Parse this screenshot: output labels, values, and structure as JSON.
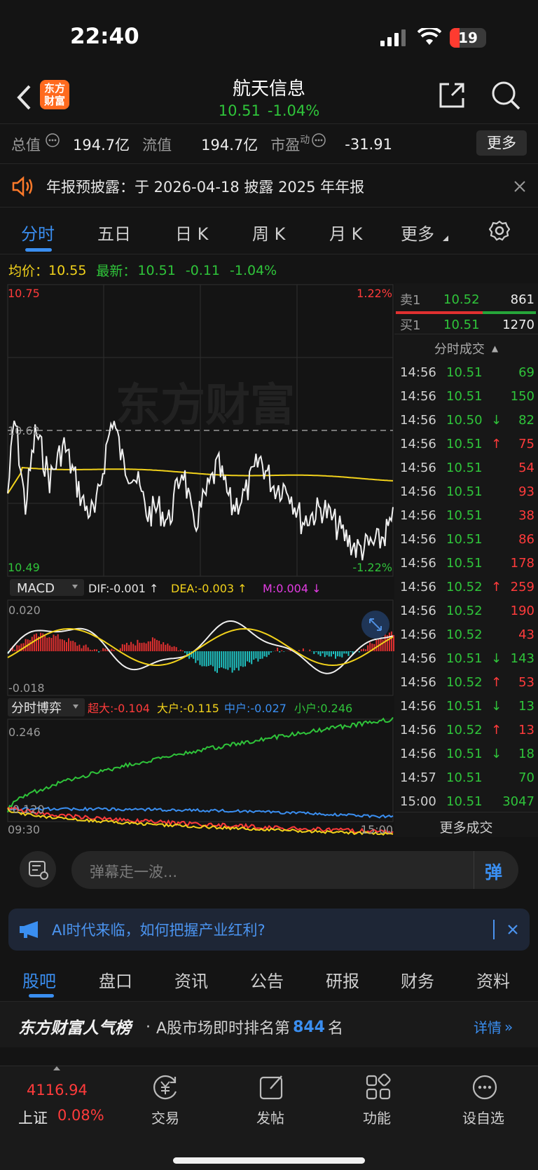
{
  "status_bar": {
    "time": "22:40",
    "battery": "19"
  },
  "nav": {
    "back_icon": "chevron-left-icon",
    "logo_text": "东方\n财富",
    "title": "航天信息",
    "price": "10.51",
    "change_pct": "-1.04%",
    "share_icon": "share-icon",
    "search_icon": "search-icon"
  },
  "stats": {
    "total_label": "总值",
    "total_value": "194.7亿",
    "float_label": "流值",
    "float_value": "194.7亿",
    "pe_label": "市盈",
    "pe_sup": "动",
    "pe_value": "-31.91",
    "more_button": "更多"
  },
  "notice": {
    "text": "年报预披露：于 2026-04-18 披露 2025 年年报",
    "close_icon": "close-icon"
  },
  "period_tabs": [
    {
      "label": "分时",
      "active": true
    },
    {
      "label": "五日"
    },
    {
      "label": "日 K"
    },
    {
      "label": "周 K"
    },
    {
      "label": "月 K"
    },
    {
      "label": "更多"
    }
  ],
  "settings_icon": "gear-icon",
  "quote_line": {
    "avg_label": "均价：",
    "avg_value": "10.55",
    "latest_label": "最新：",
    "latest_value": "10.51",
    "change": "-0.11",
    "change_pct": "-1.04%"
  },
  "price_chart": {
    "max_price": "10.75",
    "max_pct": "1.22%",
    "pre_close": "10.62",
    "min_price": "10.49",
    "min_pct": "-1.22%",
    "watermark": "东方财富"
  },
  "macd": {
    "label": "MACD",
    "dif": "DIF:-0.001 ↑",
    "dea": "DEA:-0.003 ↑",
    "m": "M:0.004 ↓",
    "max": "0.020",
    "min": "-0.018"
  },
  "game": {
    "label": "分时博弈",
    "super": "超大:-0.104",
    "large": "大户:-0.115",
    "mid": "中户:-0.027",
    "small": "小户:0.246",
    "max": "0.246",
    "min": "-0.120",
    "start_time": "09:30",
    "end_time": "15:00"
  },
  "order_book": {
    "sell": {
      "label": "卖1",
      "price": "10.52",
      "vol": "861"
    },
    "buy": {
      "label": "买1",
      "price": "10.51",
      "vol": "1270"
    },
    "trades_header": "分时成交",
    "more_trades": "更多成交"
  },
  "trades": [
    {
      "t": "14:56",
      "p": "10.51",
      "a": "",
      "v": "69",
      "pc": "g",
      "vc": "g"
    },
    {
      "t": "14:56",
      "p": "10.51",
      "a": "",
      "v": "150",
      "pc": "g",
      "vc": "g"
    },
    {
      "t": "14:56",
      "p": "10.50",
      "a": "↓",
      "v": "82",
      "pc": "g",
      "vc": "g"
    },
    {
      "t": "14:56",
      "p": "10.51",
      "a": "↑",
      "v": "75",
      "pc": "g",
      "vc": "r"
    },
    {
      "t": "14:56",
      "p": "10.51",
      "a": "",
      "v": "54",
      "pc": "g",
      "vc": "r"
    },
    {
      "t": "14:56",
      "p": "10.51",
      "a": "",
      "v": "93",
      "pc": "g",
      "vc": "r"
    },
    {
      "t": "14:56",
      "p": "10.51",
      "a": "",
      "v": "38",
      "pc": "g",
      "vc": "r"
    },
    {
      "t": "14:56",
      "p": "10.51",
      "a": "",
      "v": "86",
      "pc": "g",
      "vc": "r"
    },
    {
      "t": "14:56",
      "p": "10.51",
      "a": "",
      "v": "178",
      "pc": "g",
      "vc": "r"
    },
    {
      "t": "14:56",
      "p": "10.52",
      "a": "↑",
      "v": "259",
      "pc": "g",
      "vc": "r"
    },
    {
      "t": "14:56",
      "p": "10.52",
      "a": "",
      "v": "190",
      "pc": "g",
      "vc": "r"
    },
    {
      "t": "14:56",
      "p": "10.52",
      "a": "",
      "v": "43",
      "pc": "g",
      "vc": "r"
    },
    {
      "t": "14:56",
      "p": "10.51",
      "a": "↓",
      "v": "143",
      "pc": "g",
      "vc": "g"
    },
    {
      "t": "14:56",
      "p": "10.52",
      "a": "↑",
      "v": "53",
      "pc": "g",
      "vc": "r"
    },
    {
      "t": "14:56",
      "p": "10.51",
      "a": "↓",
      "v": "13",
      "pc": "g",
      "vc": "g"
    },
    {
      "t": "14:56",
      "p": "10.52",
      "a": "↑",
      "v": "13",
      "pc": "g",
      "vc": "r"
    },
    {
      "t": "14:56",
      "p": "10.51",
      "a": "↓",
      "v": "18",
      "pc": "g",
      "vc": "g"
    },
    {
      "t": "14:57",
      "p": "10.51",
      "a": "",
      "v": "70",
      "pc": "g",
      "vc": "g"
    },
    {
      "t": "15:00",
      "p": "10.51",
      "a": "",
      "v": "3047",
      "pc": "g",
      "vc": "g"
    }
  ],
  "barrage": {
    "placeholder": "弹幕走一波...",
    "button": "弹"
  },
  "ai_banner": {
    "text": "AI时代来临，如何把握产业红利?"
  },
  "bottom_tabs": [
    "股吧",
    "盘口",
    "资讯",
    "公告",
    "研报",
    "财务",
    "资料"
  ],
  "rank": {
    "brand": "东方财富人气榜",
    "text": "A股市场即时排名第",
    "num": "844",
    "unit": "名",
    "detail": "详情"
  },
  "dock": {
    "index_value": "4116.94",
    "index_name": "上证",
    "index_pct": "0.08%",
    "items": [
      "交易",
      "发帖",
      "功能",
      "设自选"
    ]
  },
  "colors": {
    "up": "#ff3b3b",
    "down": "#2fc43a",
    "avg": "#f2d21b",
    "accent": "#3a8ef0"
  }
}
